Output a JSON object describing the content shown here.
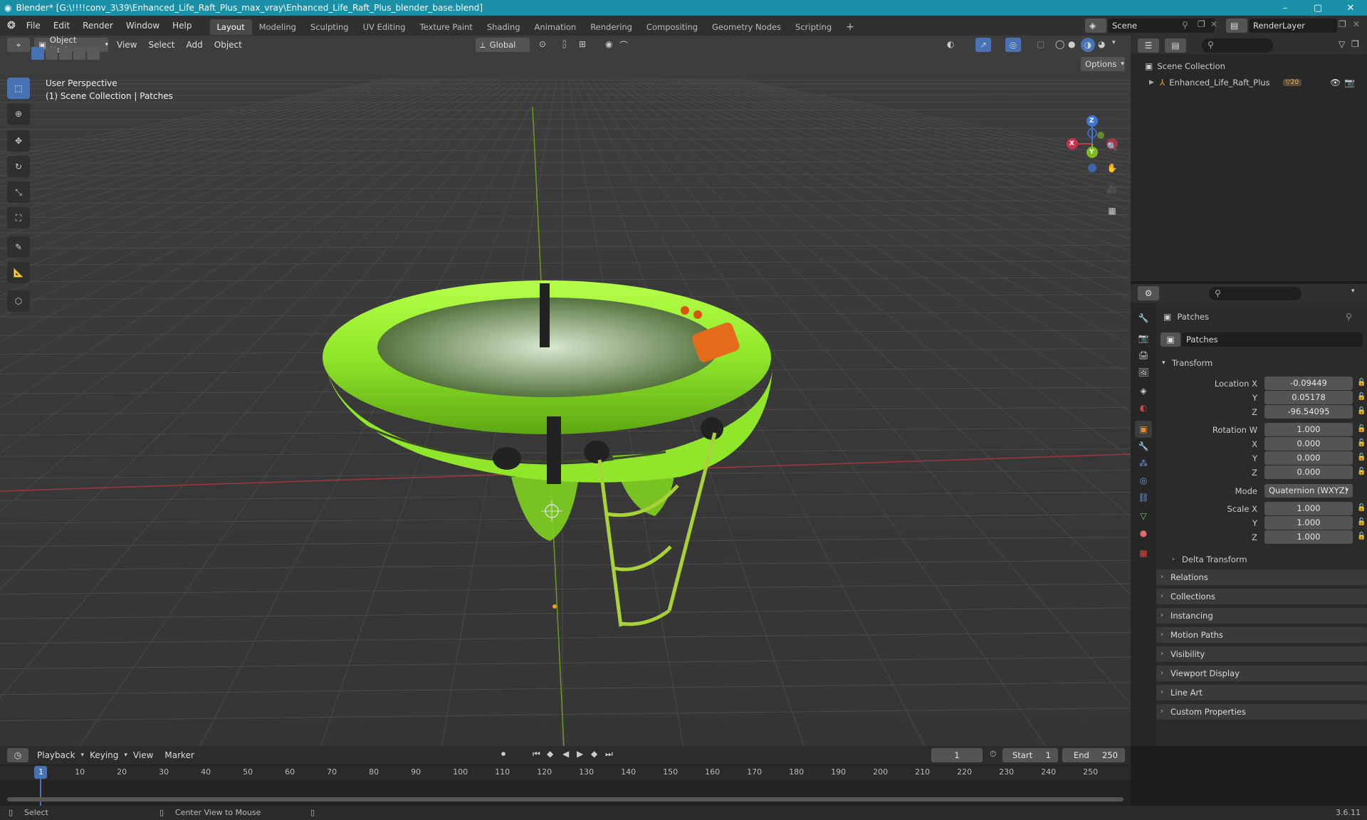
{
  "window": {
    "title": "Blender* [G:\\!!!!conv_3\\39\\Enhanced_Life_Raft_Plus_max_vray\\Enhanced_Life_Raft_Plus_blender_base.blend]",
    "controls": {
      "minimize": "–",
      "maximize": "▢",
      "close": "✕"
    }
  },
  "menubar": {
    "menus": [
      "File",
      "Edit",
      "Render",
      "Window",
      "Help"
    ],
    "workspaces": [
      "Layout",
      "Modeling",
      "Sculpting",
      "UV Editing",
      "Texture Paint",
      "Shading",
      "Animation",
      "Rendering",
      "Compositing",
      "Geometry Nodes",
      "Scripting"
    ],
    "add_tab": "+",
    "scene": "Scene",
    "view_layer": "RenderLayer"
  },
  "viewport": {
    "mode": "Object Mode",
    "menus": [
      "View",
      "Select",
      "Add",
      "Object"
    ],
    "orientation": "Global",
    "options": "Options",
    "info_line1": "User Perspective",
    "info_line2": "(1) Scene Collection | Patches",
    "gizmo": {
      "x": "X",
      "y": "Y",
      "z": "Z"
    }
  },
  "outliner": {
    "search_placeholder": "",
    "root": "Scene Collection",
    "items": [
      {
        "name": "Enhanced_Life_Raft_Plus",
        "badge": "20"
      }
    ]
  },
  "properties": {
    "object_name": "Patches",
    "data_name": "Patches",
    "transform_label": "Transform",
    "location": {
      "label": "Location X",
      "x": "-0.09449",
      "y": "0.05178",
      "z": "-96.54095"
    },
    "rotation": {
      "label": "Rotation W",
      "w": "1.000",
      "x": "0.000",
      "y": "0.000",
      "z": "0.000"
    },
    "mode_label": "Mode",
    "mode_value": "Quaternion (WXYZ)",
    "scale": {
      "label": "Scale X",
      "x": "1.000",
      "y": "1.000",
      "z": "1.000"
    },
    "axis_labels": {
      "x": "X",
      "y": "Y",
      "z": "Z"
    },
    "delta": "Delta Transform",
    "panels": [
      "Relations",
      "Collections",
      "Instancing",
      "Motion Paths",
      "Visibility",
      "Viewport Display",
      "Line Art",
      "Custom Properties"
    ]
  },
  "timeline": {
    "menus": [
      "Playback",
      "Keying",
      "View",
      "Marker"
    ],
    "current_frame": "1",
    "start_label": "Start",
    "start": "1",
    "end_label": "End",
    "end": "250",
    "ruler": [
      "1",
      "10",
      "20",
      "30",
      "40",
      "50",
      "60",
      "70",
      "80",
      "90",
      "100",
      "110",
      "120",
      "130",
      "140",
      "150",
      "160",
      "170",
      "180",
      "190",
      "200",
      "210",
      "220",
      "230",
      "240",
      "250"
    ]
  },
  "statusbar": {
    "select": "Select",
    "center": "Center View to Mouse",
    "version": "3.6.11"
  },
  "colors": {
    "accent": "#4772b3",
    "raft_green": "#8fe62a",
    "axis_x": "#c7334c",
    "axis_y": "#7fbb1e",
    "axis_z": "#3e78d4",
    "titlebar": "#1a8fa8"
  }
}
